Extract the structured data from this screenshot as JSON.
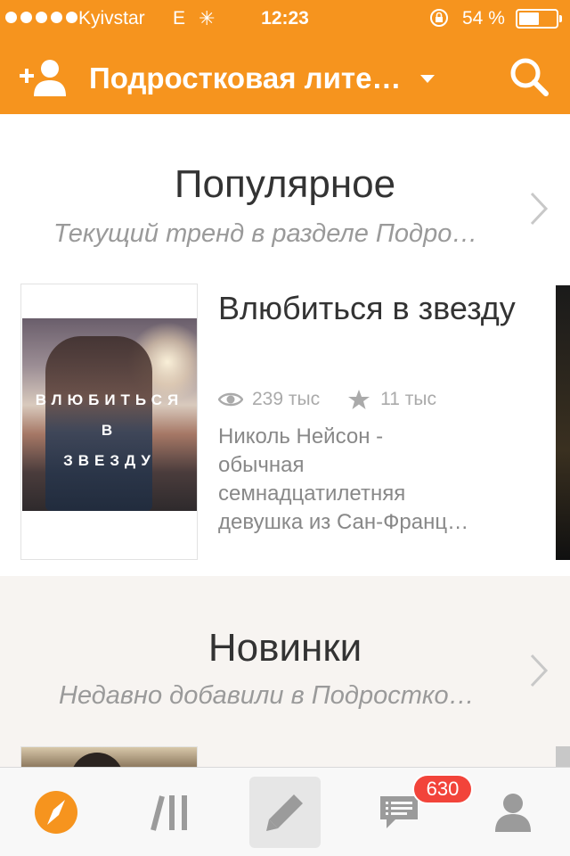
{
  "status_bar": {
    "carrier": "Kyivstar",
    "network": "E",
    "time": "12:23",
    "battery_percent": "54 %",
    "battery_level": 0.54
  },
  "nav_bar": {
    "title": "Подростковая лите…",
    "icons": [
      "add-user-icon",
      "dropdown-caret-icon",
      "search-icon"
    ]
  },
  "sections": [
    {
      "title": "Популярное",
      "subtitle": "Текущий тренд в разделе Подро…",
      "book": {
        "title": "Влюбиться в звезду",
        "cover_lines": [
          "ВЛЮБИТЬСЯ",
          "В",
          "ЗВЕЗДУ"
        ],
        "views": "239 тыс",
        "votes": "11 тыс",
        "description_lines": [
          "Николь Нейсон -",
          "обычная",
          "семнадцатилетняя",
          "девушка из Сан-Франц…"
        ]
      }
    },
    {
      "title": "Новинки",
      "subtitle": "Недавно добавили в Подростко…"
    }
  ],
  "tab_bar": {
    "tabs": [
      "discover-icon",
      "library-icon",
      "write-icon",
      "messages-icon",
      "profile-icon"
    ],
    "active_tab": "discover",
    "messages_badge": "630"
  },
  "colors": {
    "accent": "#f6941e",
    "badge": "#f2443a",
    "inactive_icon": "#9b9b9b"
  }
}
